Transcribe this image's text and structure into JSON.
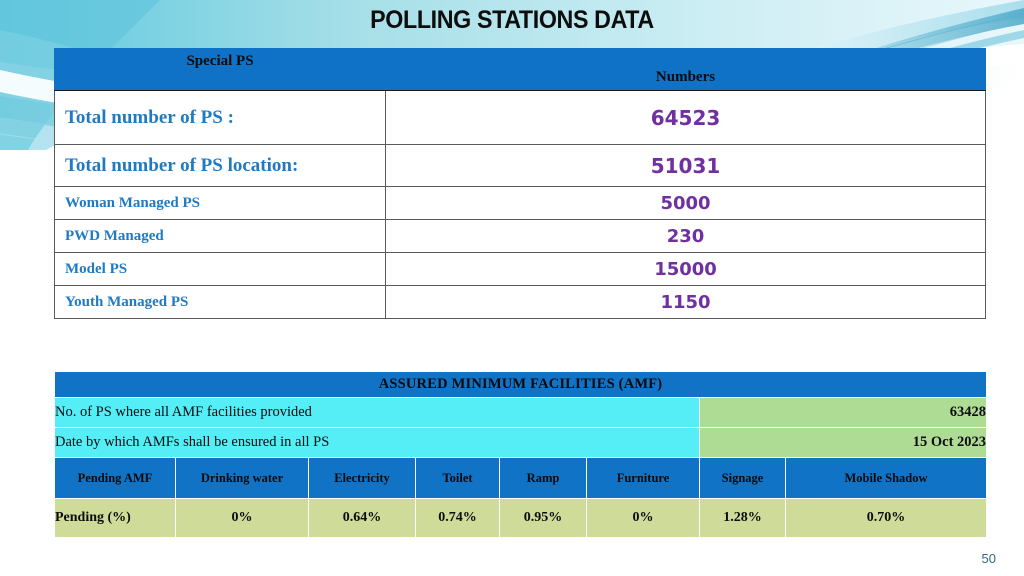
{
  "slide": {
    "title": "POLLING STATIONS DATA",
    "page_number": "50"
  },
  "colors": {
    "header_blue": "#0F72C6",
    "label_blue": "#1F7AC4",
    "number_purple": "#7030A0",
    "cyan": "#55EEF7",
    "light_green": "#AEDC94",
    "khaki": "#CEDB99"
  },
  "ps_table": {
    "headers": [
      "Special PS",
      "Numbers"
    ],
    "rows": [
      {
        "label": "Total number of PS :",
        "value": "64523"
      },
      {
        "label": "Total number of PS location:",
        "value": "51031"
      },
      {
        "label": "Woman Managed PS",
        "value": "5000"
      },
      {
        "label": "PWD Managed",
        "value": "230"
      },
      {
        "label": "Model PS",
        "value": "15000"
      },
      {
        "label": "Youth Managed PS",
        "value": "1150"
      }
    ]
  },
  "amf_table": {
    "title": "ASSURED MINIMUM FACILITIES (AMF)",
    "summary_rows": [
      {
        "question": "No. of PS where all AMF facilities provided",
        "answer": "63428"
      },
      {
        "question": "Date by which AMFs shall be ensured in all PS",
        "answer": "15 Oct 2023"
      }
    ],
    "column_headers": [
      "Pending AMF",
      "Drinking water",
      "Electricity",
      "Toilet",
      "Ramp",
      "Furniture",
      "Signage",
      "Mobile Shadow"
    ],
    "values": [
      "Pending (%)",
      "0%",
      "0.64%",
      "0.74%",
      "0.95%",
      "0%",
      "1.28%",
      "0.70%"
    ]
  }
}
